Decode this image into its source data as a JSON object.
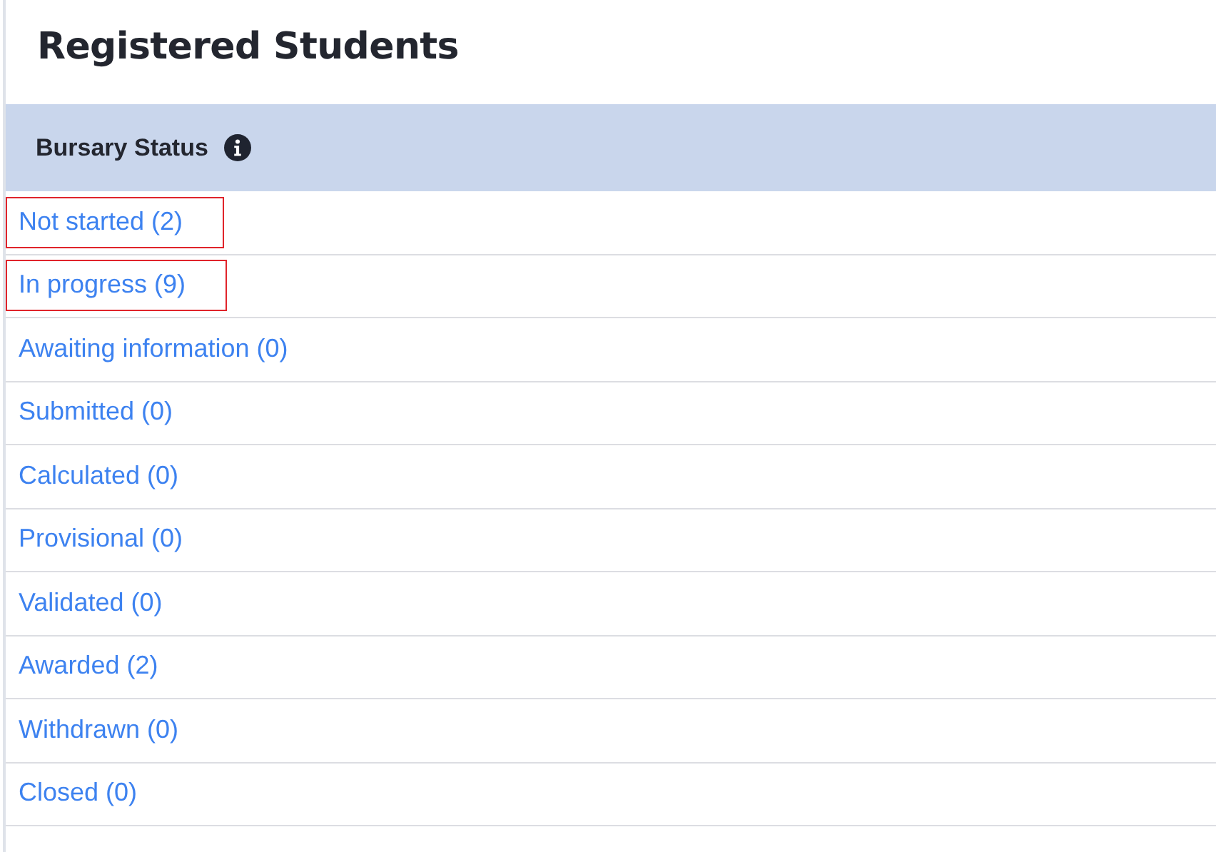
{
  "title": "Registered Students",
  "table": {
    "header": "Bursary Status",
    "rows": [
      {
        "label": "Not started (2)",
        "highlighted": true
      },
      {
        "label": "In progress (9)",
        "highlighted": true
      },
      {
        "label": "Awaiting information (0)",
        "highlighted": false
      },
      {
        "label": "Submitted (0)",
        "highlighted": false
      },
      {
        "label": "Calculated (0)",
        "highlighted": false
      },
      {
        "label": "Provisional (0)",
        "highlighted": false
      },
      {
        "label": "Validated (0)",
        "highlighted": false
      },
      {
        "label": "Awarded (2)",
        "highlighted": false
      },
      {
        "label": "Withdrawn (0)",
        "highlighted": false
      },
      {
        "label": "Closed (0)",
        "highlighted": false
      }
    ]
  }
}
